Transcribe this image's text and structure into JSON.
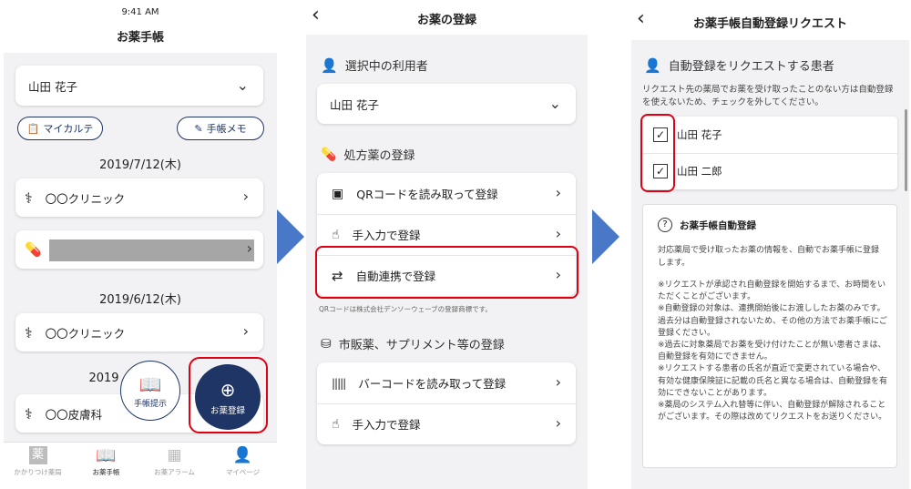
{
  "screen1": {
    "status_time": "9:41 AM",
    "title": "お薬手帳",
    "patient": "山田 花子",
    "pill_karte": "マイカルテ",
    "pill_memo": "手帳メモ",
    "date1": "2019/7/12(木)",
    "clinic1": "〇〇クリニック",
    "date2": "2019/6/12(木)",
    "clinic2": "〇〇クリニック",
    "date3_partial": "2019",
    "clinic3": "〇〇皮膚科",
    "fab_show": "手帳提示",
    "fab_register": "お薬登録",
    "nav": [
      "かかりつけ薬局",
      "お薬手帳",
      "お薬アラーム",
      "マイページ"
    ],
    "nav_icon_char": "薬"
  },
  "screen2": {
    "title": "お薬の登録",
    "section_user": "選択中の利用者",
    "patient": "山田 花子",
    "section_rx": "処方薬の登録",
    "rx_items": [
      "QRコードを読み取って登録",
      "手入力で登録",
      "自動連携で登録"
    ],
    "note": "QRコードは株式会社デンソーウェーブの登録商標です。",
    "section_otc": "市販薬、サプリメント等の登録",
    "otc_items": [
      "バーコードを読み取って登録",
      "手入力で登録"
    ]
  },
  "screen3": {
    "title": "お薬手帳自動登録リクエスト",
    "section": "自動登録をリクエストする患者",
    "desc": "リクエスト先の薬局でお薬を受け取ったことのない方は自動登録を使えないため、チェックを外してください。",
    "patients": [
      "山田 花子",
      "山田 二郎"
    ],
    "info_title": "お薬手帳自動登録",
    "info_lead": "対応薬局で受け取ったお薬の情報を、自動でお薬手帳に登録します。",
    "info_notes": "※リクエストが承認され自動登録を開始するまで、お時間をいただくことがございます。\n※自動登録の対象は、連携開始後にお渡ししたお薬のみです。過去分は自動登録されないため、その他の方法でお薬手帳にご登録ください。\n※過去に対象薬局でお薬を受け付けたことが無い患者さまは、自動登録を有効にできません。\n※リクエストする患者の氏名が直近で変更されている場合や、有効な健康保険証に記載の氏名と異なる場合は、自動登録を有効にできないことがあります。\n※薬局のシステム入れ替等に伴い、自動登録が解除されることがございます。その際は改めてリクエストをお送りください。"
  },
  "colors": {
    "navy": "#1e3566",
    "highlight": "#e00012",
    "arrow": "#4a78c8"
  }
}
